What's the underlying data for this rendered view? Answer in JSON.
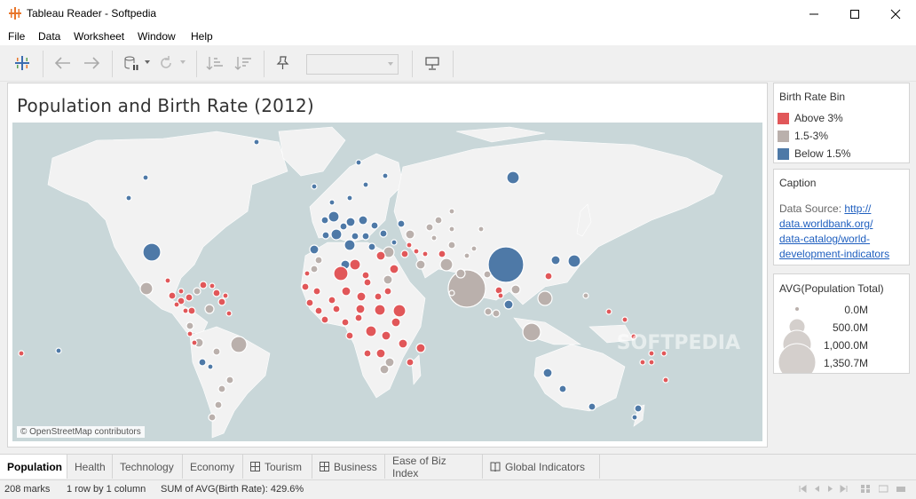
{
  "window": {
    "title": "Tableau Reader - Softpedia"
  },
  "menu": [
    "File",
    "Data",
    "Worksheet",
    "Window",
    "Help"
  ],
  "toolbar": {
    "icons": [
      "tableau-logo-icon",
      "back-arrow-icon",
      "forward-arrow-icon",
      "pause-data-icon",
      "refresh-icon",
      "sort-ascending-icon",
      "sort-descending-icon",
      "pin-icon",
      "presentation-icon"
    ],
    "dropdown_value": ""
  },
  "viz": {
    "title": "Population and Birth Rate (2012)",
    "attribution": "© OpenStreetMap contributors"
  },
  "legend": {
    "title": "Birth Rate Bin",
    "items": [
      {
        "label": "Above 3%",
        "color": "#e15759"
      },
      {
        "label": "1.5-3%",
        "color": "#bab0ac"
      },
      {
        "label": "Below 1.5%",
        "color": "#4e79a7"
      }
    ]
  },
  "caption": {
    "title": "Caption",
    "prefix": "Data Source: ",
    "link": "http://data.worldbank.org/data-catalog/world-development-indicators",
    "link_lines": [
      "http://",
      "data.worldbank.org/",
      "data-catalog/world-",
      "development-indicators"
    ]
  },
  "size_legend": {
    "title": "AVG(Population Total)",
    "items": [
      "0.0M",
      "500.0M",
      "1,000.0M",
      "1,350.7M"
    ]
  },
  "tabs": [
    {
      "label": "Population",
      "active": true,
      "icon": ""
    },
    {
      "label": "Health",
      "active": false,
      "icon": ""
    },
    {
      "label": "Technology",
      "active": false,
      "icon": ""
    },
    {
      "label": "Economy",
      "active": false,
      "icon": ""
    },
    {
      "label": "Tourism",
      "active": false,
      "icon": "dashboard-icon"
    },
    {
      "label": "Business",
      "active": false,
      "icon": "dashboard-icon"
    },
    {
      "label": "Ease of Biz Index",
      "active": false,
      "icon": ""
    },
    {
      "label": "Global Indicators",
      "active": false,
      "icon": "story-icon"
    }
  ],
  "status": {
    "marks": "208 marks",
    "rows": "1 row by 1 column",
    "sum": "SUM of AVG(Birth Rate): 429.6%"
  },
  "watermark": "SOFTPEDIA",
  "colors": {
    "above": "#e15759",
    "mid": "#bab0ac",
    "below": "#4e79a7",
    "ocean": "#c9d7d9",
    "land": "#f2f2f2"
  }
}
